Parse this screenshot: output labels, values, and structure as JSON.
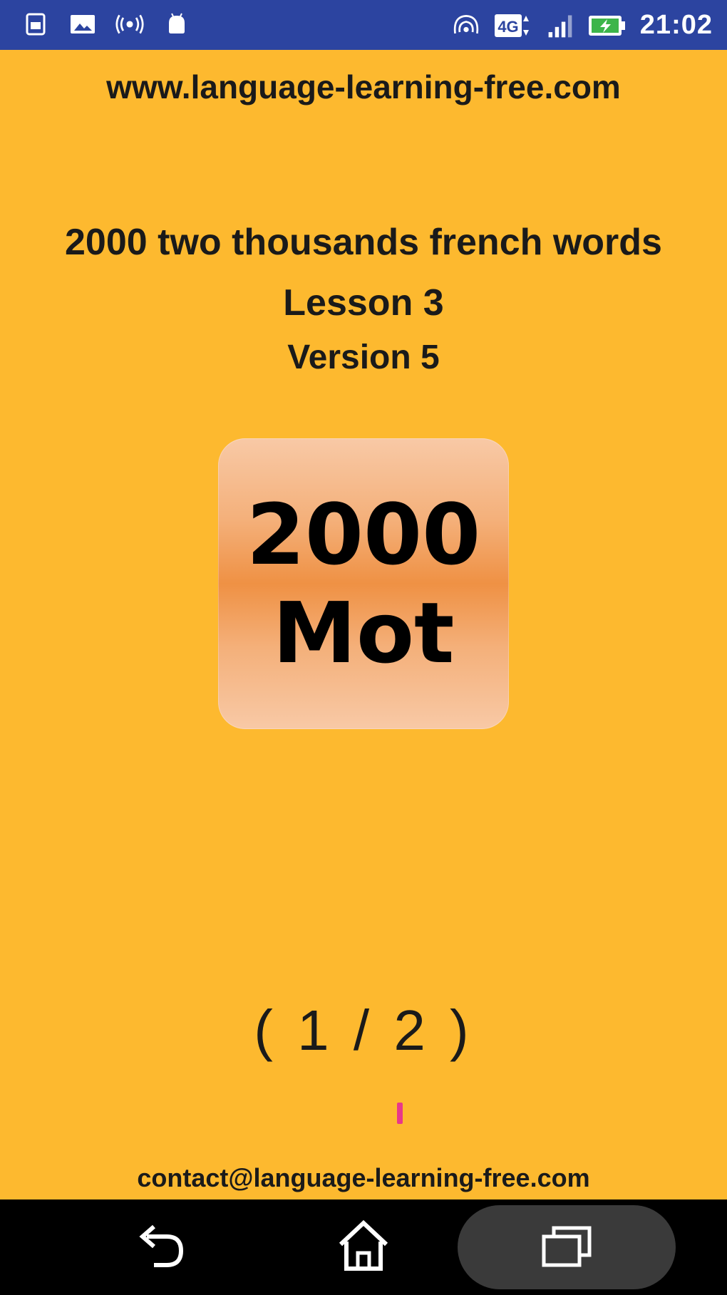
{
  "status_bar": {
    "time": "21:02",
    "network": "4G",
    "left_icons": [
      "sim-icon",
      "photo-icon",
      "broadcast-icon",
      "android-icon"
    ],
    "right_icons": [
      "hotspot-icon",
      "network-4g-icon",
      "signal-icon",
      "battery-charging-icon"
    ],
    "colors": {
      "background": "#2C44A0",
      "text": "#FFFFFF"
    }
  },
  "header": {
    "site_url": "www.language-learning-free.com"
  },
  "info": {
    "title": "2000 two thousands french words",
    "lesson": "Lesson 3",
    "version": "Version 5"
  },
  "logo": {
    "line1": "2000",
    "line2": "Mot"
  },
  "pager": {
    "text": "( 1 / 2 )"
  },
  "footer": {
    "contact": "contact@language-learning-free.com"
  },
  "nav_bar": {
    "buttons": [
      "back-icon",
      "home-icon",
      "recent-apps-icon"
    ]
  },
  "colors": {
    "background": "#FDB92F",
    "logo_gradient_center": "#EF9144",
    "logo_gradient_edge": "#F8C9A6",
    "accent_mark": "#E8388A"
  }
}
